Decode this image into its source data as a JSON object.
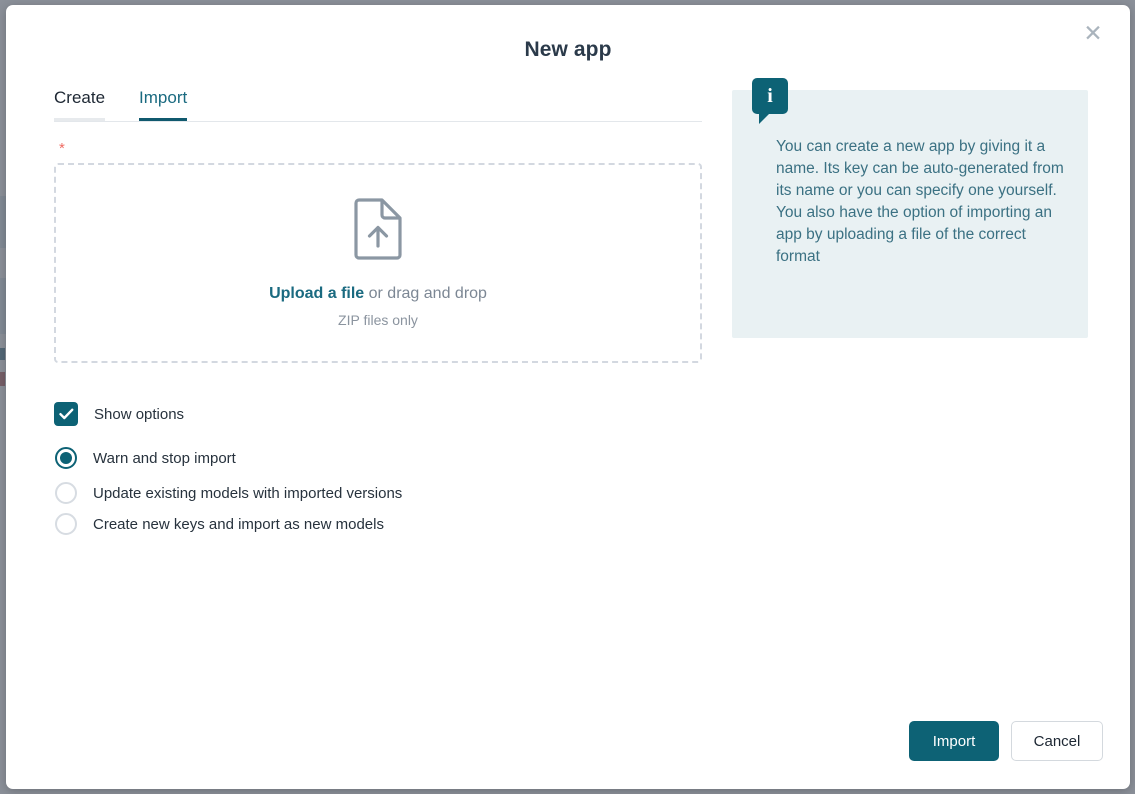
{
  "dialog": {
    "title": "New app",
    "close_icon": "close-icon"
  },
  "tabs": [
    {
      "label": "Create",
      "active": false
    },
    {
      "label": "Import",
      "active": true
    }
  ],
  "form": {
    "required_marker": "*",
    "dropzone": {
      "icon": "file-upload-icon",
      "link_text": "Upload a file",
      "rest_text": " or drag and drop",
      "hint": "ZIP files only"
    },
    "show_options": {
      "label": "Show options",
      "checked": true
    },
    "import_mode": {
      "selected": "Warn and stop import",
      "options": [
        "Warn and stop import",
        "Update existing models with imported versions",
        "Create new keys and import as new models"
      ]
    }
  },
  "info": {
    "icon": "info-icon",
    "text": "You can create a new app by giving it a name. Its key can be auto-generated from its name or you can specify one yourself. You also have the option of importing an app by uploading a file of the correct format"
  },
  "footer": {
    "primary_label": "Import",
    "secondary_label": "Cancel"
  },
  "colors": {
    "accent": "#0d6275",
    "accent_text": "#1a6a80",
    "info_bg": "#e9f1f3",
    "info_text": "#3b7183",
    "required": "#ef6c63",
    "backdrop": "#8b9099"
  }
}
